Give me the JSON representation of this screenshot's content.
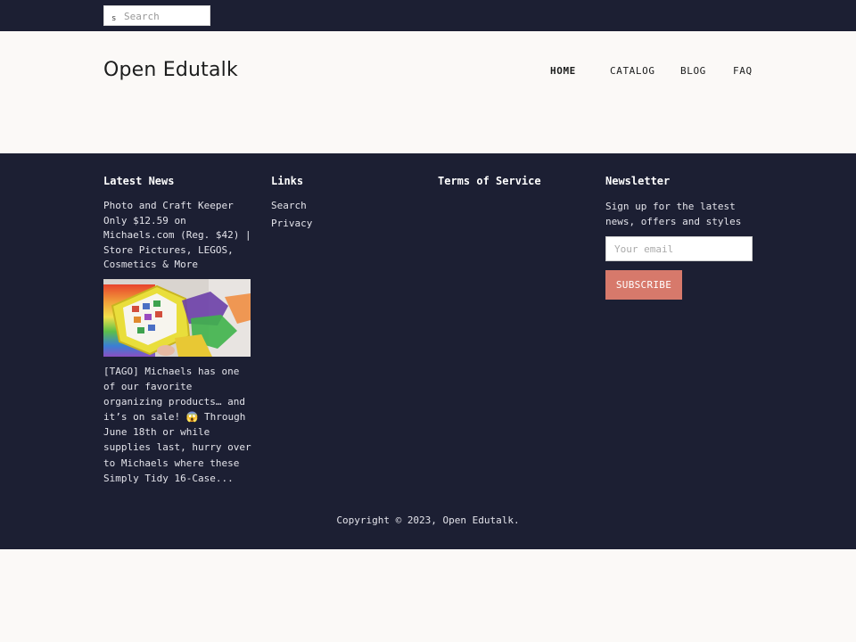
{
  "topbar": {
    "search": {
      "icon": "search-icon",
      "icon_glyph": "s",
      "placeholder": "Search",
      "value": ""
    }
  },
  "header": {
    "logo": "Open Edutalk",
    "nav": [
      {
        "label": "HOME",
        "active": true
      },
      {
        "label": "CATALOG",
        "active": false
      },
      {
        "label": "BLOG",
        "active": false
      },
      {
        "label": "FAQ",
        "active": false
      }
    ]
  },
  "footer": {
    "latest_news": {
      "title": "Latest News",
      "article_title": "Photo and Craft Keeper Only $12.59 on Michaels.com (Reg. $42) | Store Pictures, LEGOS, Cosmetics & More",
      "excerpt": "[TAGO] Michaels has one of our favorite organizing products… and it’s on sale! 😱 Through June 18th or while supplies last, hurry over to Michaels where these Simply Tidy 16-Case..."
    },
    "links": {
      "title": "Links",
      "items": [
        "Search",
        "Privacy"
      ]
    },
    "terms": {
      "title": "Terms of Service"
    },
    "newsletter": {
      "title": "Newsletter",
      "text": "Sign up for the latest news, offers and styles",
      "email_placeholder": "Your email",
      "email_value": "",
      "subscribe_label": "SUBSCRIBE"
    },
    "copyright": "Copyright © 2023, Open Edutalk."
  },
  "colors": {
    "dark_navy": "#1c1f33",
    "page_bg": "#fbf9f7",
    "accent": "#d7796b"
  }
}
